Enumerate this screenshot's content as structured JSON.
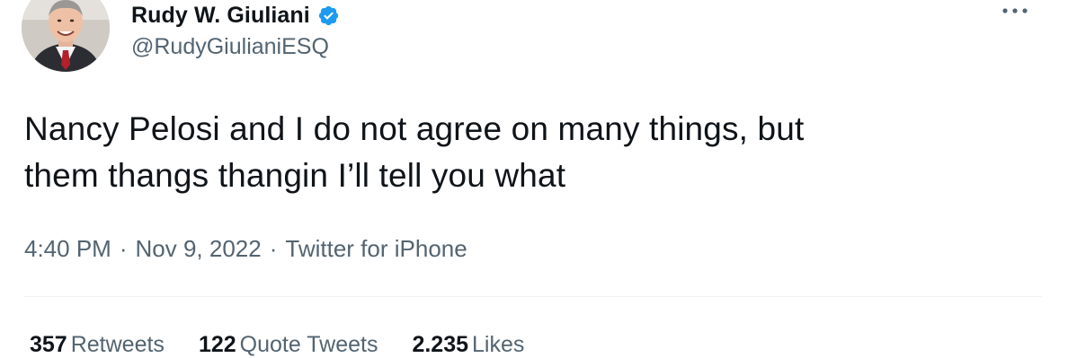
{
  "author": {
    "display_name": "Rudy W. Giuliani",
    "handle": "@RudyGiulianiESQ",
    "verified_color": "#1d9bf0",
    "avatar_icon": "profile-photo"
  },
  "more_icon": "more-horizontal-icon",
  "tweet": {
    "lines": [
      "Nancy Pelosi and I do not agree on many things, but",
      "them thangs thangin I’ll tell you what"
    ]
  },
  "meta": {
    "time": "4:40 PM",
    "date": "Nov 9, 2022",
    "source": "Twitter for iPhone",
    "separator": "·"
  },
  "stats": {
    "retweets_count": "357",
    "retweets_label": "Retweets",
    "quotes_count": "122",
    "quotes_label": "Quote Tweets",
    "likes_count": "2.235",
    "likes_label": "Likes"
  },
  "colors": {
    "text_primary": "#0f1419",
    "text_secondary": "#536471",
    "divider": "#eff3f4"
  }
}
